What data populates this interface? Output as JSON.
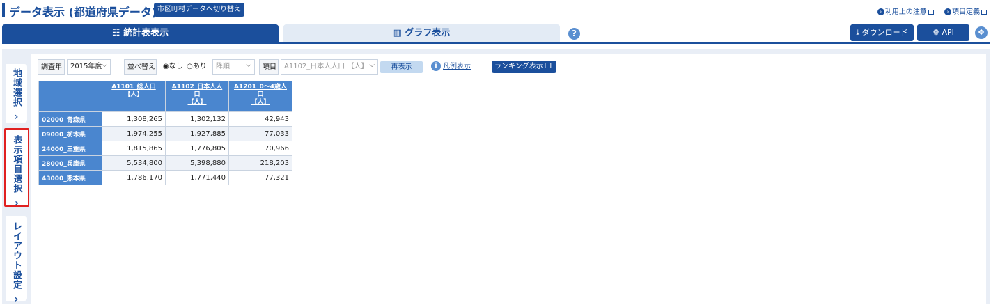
{
  "header": {
    "title": "データ表示 (都道府県データ)",
    "switch_button": "市区町村データへ切り替え",
    "links": [
      "利用上の注意",
      "項目定義"
    ]
  },
  "tabs": {
    "table": "統計表表示",
    "graph": "グラフ表示",
    "help": "?"
  },
  "actions": {
    "download": "ダウンロード",
    "api": "API"
  },
  "side_tabs": {
    "region": "地域選択",
    "items": "表示項目選択",
    "layout": "レイアウト設定"
  },
  "filters": {
    "year_label": "調査年",
    "year_value": "2015年度",
    "sort_label": "並べ替え",
    "sort_options": [
      "なし",
      "あり"
    ],
    "order_value": "降順",
    "item_label": "項目",
    "item_value": "A1102_日本人人口 【人】",
    "redisplay": "再表示",
    "legend": "凡例表示",
    "ranking": "ランキング表示"
  },
  "table": {
    "columns": [
      {
        "line1": "A1101_総人口",
        "line2": "【人】"
      },
      {
        "line1": "A1102_日本人人",
        "line2": "口",
        "line3": "【人】"
      },
      {
        "line1": "A1201_0～4歳人",
        "line2": "口",
        "line3": "【人】"
      }
    ],
    "rows": [
      {
        "label": "02000_青森県",
        "values": [
          "1,308,265",
          "1,302,132",
          "42,943"
        ]
      },
      {
        "label": "09000_栃木県",
        "values": [
          "1,974,255",
          "1,927,885",
          "77,033"
        ]
      },
      {
        "label": "24000_三重県",
        "values": [
          "1,815,865",
          "1,776,805",
          "70,966"
        ]
      },
      {
        "label": "28000_兵庫県",
        "values": [
          "5,534,800",
          "5,398,880",
          "218,203"
        ]
      },
      {
        "label": "43000_熊本県",
        "values": [
          "1,786,170",
          "1,771,440",
          "77,321"
        ]
      }
    ]
  }
}
